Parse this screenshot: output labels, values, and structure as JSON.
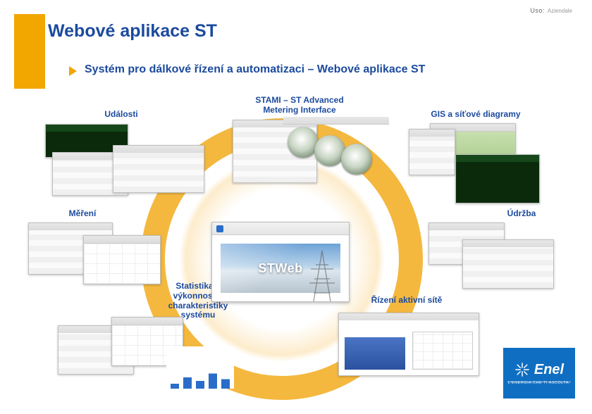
{
  "header": {
    "uso": "Uso:",
    "scope": "Aziendale"
  },
  "title": "Webové aplikace ST",
  "subtitle": "Systém pro dálkové řízení a automatizaci – Webové aplikace ST",
  "labels": {
    "events": "Události",
    "ami": "STAMI – ST Advanced\nMetering Interface",
    "gis": "GIS a síťové diagramy",
    "measure": "Měření",
    "maint": "Údržba",
    "stats": "Statistika a\nvýkonnostní\ncharakteristiky\nsystému",
    "active": "Řízení aktivní sítě"
  },
  "center_brand": "STWeb",
  "logo": {
    "name": "Enel",
    "tagline": "L'ENERGIA CHE TI ASCOLTA."
  }
}
